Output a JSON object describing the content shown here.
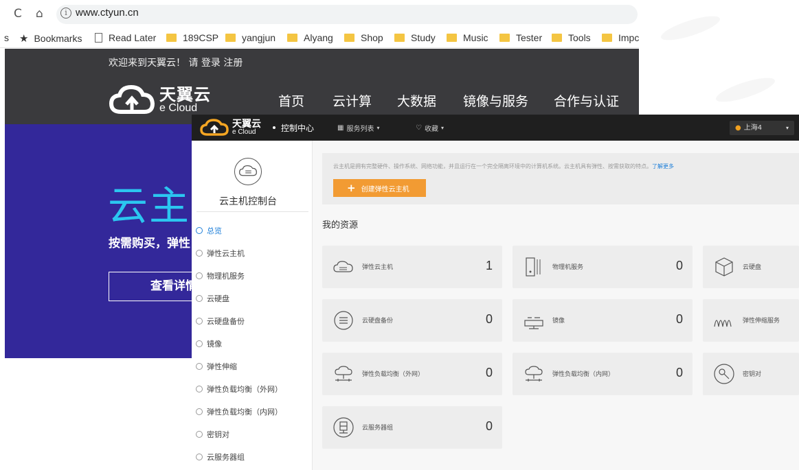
{
  "browser": {
    "url": "www.ctyun.cn",
    "bookmarks_leading": "s",
    "bookmarks": [
      {
        "label": "Bookmarks",
        "icon": "star-icon"
      },
      {
        "label": "Read Later",
        "icon": "page-icon"
      },
      {
        "label": "189CSP",
        "icon": "folder-icon"
      },
      {
        "label": "yangjun",
        "icon": "folder-icon"
      },
      {
        "label": "Alyang",
        "icon": "folder-icon"
      },
      {
        "label": "Shop",
        "icon": "folder-icon"
      },
      {
        "label": "Study",
        "icon": "folder-icon"
      },
      {
        "label": "Music",
        "icon": "folder-icon"
      },
      {
        "label": "Tester",
        "icon": "folder-icon"
      },
      {
        "label": "Tools",
        "icon": "folder-icon"
      },
      {
        "label": "Impc",
        "icon": "folder-icon"
      }
    ]
  },
  "site": {
    "welcome": "欢迎来到天翼云！ 请 登录  注册",
    "logo_cn": "天翼云",
    "logo_en": "e Cloud",
    "nav": [
      "首页",
      "云计算",
      "大数据",
      "镜像与服务",
      "合作与认证"
    ],
    "hero_title": "云主",
    "hero_sub": "按需购买，弹性",
    "hero_button": "查看详情"
  },
  "console": {
    "logo_cn": "天翼云",
    "logo_en": "e Cloud",
    "center_label": "控制中心",
    "service_list": "服务列表",
    "favorites": "收藏",
    "region": "上海4",
    "sidebar": {
      "title": "云主机控制台",
      "items": [
        {
          "label": "总览",
          "active": true
        },
        {
          "label": "弹性云主机",
          "active": false
        },
        {
          "label": "物理机服务",
          "active": false
        },
        {
          "label": "云硬盘",
          "active": false
        },
        {
          "label": "云硬盘备份",
          "active": false
        },
        {
          "label": "镜像",
          "active": false
        },
        {
          "label": "弹性伸缩",
          "active": false
        },
        {
          "label": "弹性负载均衡（外网）",
          "active": false
        },
        {
          "label": "弹性负载均衡（内网）",
          "active": false
        },
        {
          "label": "密钥对",
          "active": false
        },
        {
          "label": "云服务器组",
          "active": false
        }
      ]
    },
    "intro_text": "云主机是拥有完整硬件、操作系统、网络功能，并且运行在一个完全隔离环境中的计算机系统。云主机具有弹性、按需获取的特点。",
    "intro_link": "了解更多",
    "create_button": "创建弹性云主机",
    "resources_title": "我的资源",
    "resources": [
      {
        "label": "弹性云主机",
        "count": "1",
        "icon": "cloud-server-icon"
      },
      {
        "label": "物理机服务",
        "count": "0",
        "icon": "physical-server-icon"
      },
      {
        "label": "云硬盘",
        "count": "",
        "icon": "cube-icon"
      },
      {
        "label": "云硬盘备份",
        "count": "0",
        "icon": "backup-icon"
      },
      {
        "label": "镜像",
        "count": "0",
        "icon": "image-icon"
      },
      {
        "label": "弹性伸缩服务",
        "count": "",
        "icon": "scaling-icon"
      },
      {
        "label": "弹性负载均衡（外网）",
        "count": "0",
        "icon": "load-balancer-icon"
      },
      {
        "label": "弹性负载均衡（内网）",
        "count": "0",
        "icon": "load-balancer-icon"
      },
      {
        "label": "密钥对",
        "count": "",
        "icon": "key-icon"
      },
      {
        "label": "云服务器组",
        "count": "0",
        "icon": "server-group-icon"
      }
    ]
  },
  "colors": {
    "hero_bg": "#33289a",
    "hero_title": "#2bc6f0",
    "site_header": "#3a3a3d",
    "console_header": "#1f1f1f",
    "accent_orange": "#f29b33",
    "link_blue": "#1e7fd9"
  }
}
